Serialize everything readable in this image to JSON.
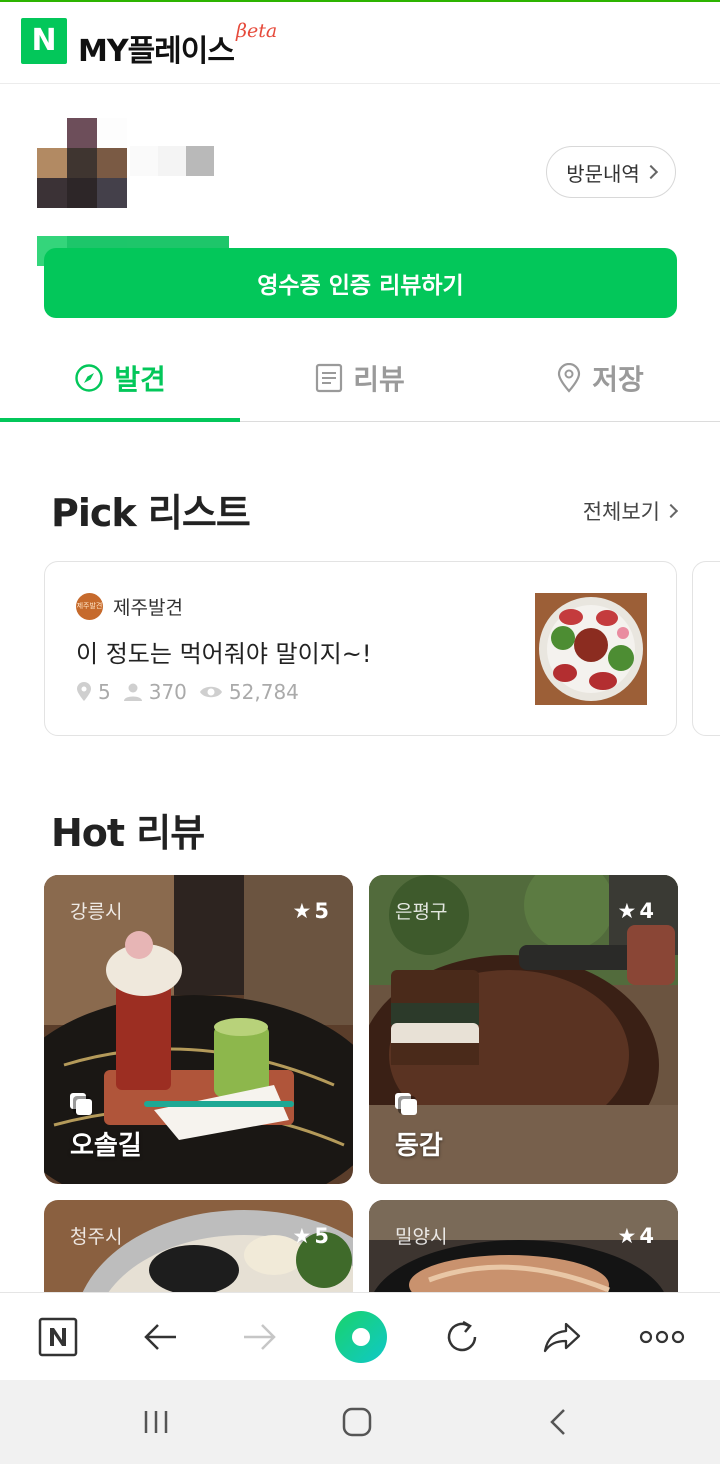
{
  "header": {
    "logo_letter": "N",
    "brand": "MY플레이스",
    "beta": "βeta"
  },
  "profile": {
    "visit_history_label": "방문내역",
    "receipt_review_button": "영수증 인증 리뷰하기"
  },
  "tabs": [
    {
      "label": "발견",
      "icon": "compass-icon",
      "active": true
    },
    {
      "label": "리뷰",
      "icon": "document-icon",
      "active": false
    },
    {
      "label": "저장",
      "icon": "location-pin-icon",
      "active": false
    }
  ],
  "pick_list": {
    "title": "Pick 리스트",
    "see_all": "전체보기",
    "card": {
      "author": "제주발견",
      "author_icon_text": "제주발견",
      "title": "이 정도는 먹어줘야 말이지~!",
      "places": "5",
      "followers": "370",
      "views": "52,784"
    }
  },
  "hot_review": {
    "title": "Hot 리뷰",
    "items": [
      {
        "location": "강릉시",
        "rating": "5",
        "name": "오솔길"
      },
      {
        "location": "은평구",
        "rating": "4",
        "name": "동감"
      },
      {
        "location": "청주시",
        "rating": "5",
        "name": ""
      },
      {
        "location": "밀양시",
        "rating": "4",
        "name": ""
      }
    ]
  },
  "colors": {
    "brand_green": "#03c75a",
    "beta_red": "#e64a3b"
  }
}
